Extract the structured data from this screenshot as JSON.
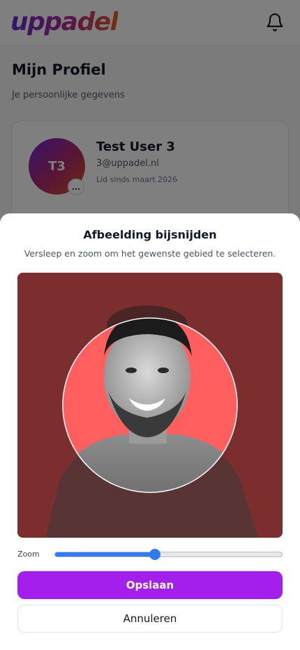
{
  "header": {
    "logo_text": "uppadel",
    "notification_icon": "bell-icon"
  },
  "page": {
    "title": "Mijn Profiel",
    "subtitle": "Je persoonlijke gegevens"
  },
  "profile": {
    "initials": "T3",
    "menu_glyph": "...",
    "name": "Test User 3",
    "email": "3@uppadel.nl",
    "member_since": "Lid sinds maart 2026"
  },
  "crop_dialog": {
    "title": "Afbeelding bijsnijden",
    "description": "Versleep en zoom om het gewenste gebied te selecteren.",
    "image_alt": "profile photo",
    "zoom_label": "Zoom",
    "zoom_value": 0.44,
    "save_label": "Opslaan",
    "cancel_label": "Annuleren"
  },
  "colors": {
    "brand_purple": "#a31fec",
    "slider_blue": "#2f7bf0",
    "crop_backdrop": "#7c2e2e",
    "crop_circle": "#ff5f5f"
  }
}
